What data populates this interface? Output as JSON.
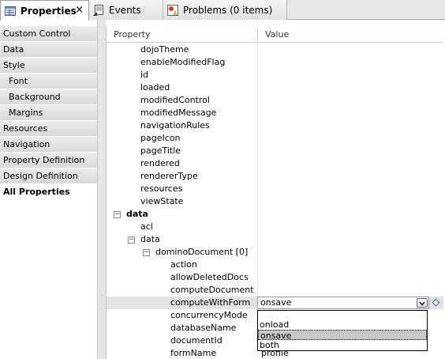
{
  "tabs": [
    {
      "label": "Properties",
      "icon": "properties-icon",
      "active": true,
      "close": "×"
    },
    {
      "label": "Events",
      "icon": "events-icon",
      "active": false
    },
    {
      "label": "Problems (0 items)",
      "icon": "problems-icon",
      "active": false
    }
  ],
  "categories": [
    "Custom Control",
    "Data",
    "Style",
    "Font",
    "Background",
    "Margins",
    "Resources",
    "Navigation",
    "Property Definition",
    "Design Definition",
    "All Properties"
  ],
  "grid": {
    "header_property": "Property",
    "header_value": "Value",
    "rows": [
      {
        "name": "dojoTheme"
      },
      {
        "name": "enableModifiedFlag"
      },
      {
        "name": "id"
      },
      {
        "name": "loaded"
      },
      {
        "name": "modifiedControl"
      },
      {
        "name": "modifiedMessage"
      },
      {
        "name": "navigationRules"
      },
      {
        "name": "pageIcon"
      },
      {
        "name": "pageTitle"
      },
      {
        "name": "rendered"
      },
      {
        "name": "rendererType"
      },
      {
        "name": "resources"
      },
      {
        "name": "viewState"
      },
      {
        "name": "data",
        "toggle": "−"
      },
      {
        "name": "acl"
      },
      {
        "name": "data",
        "toggle": "−"
      },
      {
        "name": "dominoDocument [0]",
        "toggle": "−"
      },
      {
        "name": "action"
      },
      {
        "name": "allowDeletedDocs"
      },
      {
        "name": "computeDocument"
      },
      {
        "name": "computeWithForm",
        "value": "onsave"
      },
      {
        "name": "concurrencyMode"
      },
      {
        "name": "databaseName"
      },
      {
        "name": "documentId"
      },
      {
        "name": "formName",
        "value": "profile"
      }
    ]
  },
  "dropdown": {
    "options": [
      "onload",
      "onsave",
      "both"
    ],
    "selected": "onsave"
  }
}
